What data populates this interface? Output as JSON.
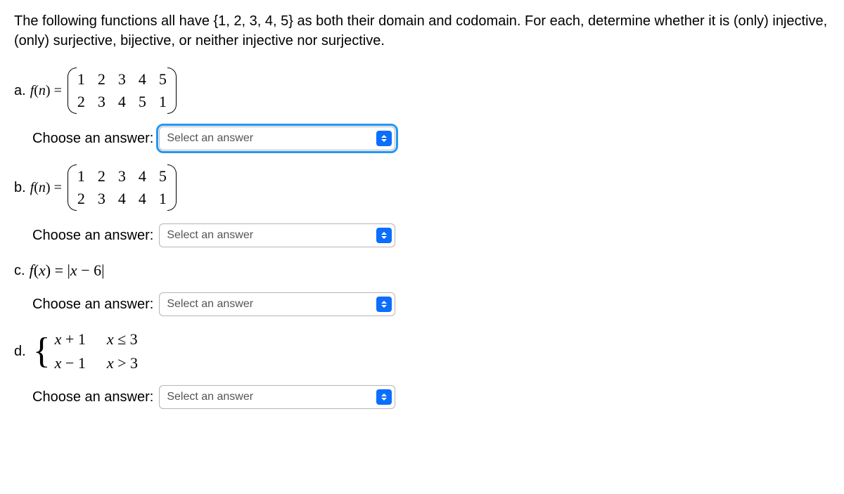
{
  "intro": "The following functions all have {1, 2, 3, 4, 5} as both their domain and codomain. For each, determine whether it is (only) injective, (only) surjective, bijective, or neither injective nor surjective.",
  "parts": {
    "a": {
      "label": "a.",
      "fn_left": "f(n) =",
      "matrix_top": [
        "1",
        "2",
        "3",
        "4",
        "5"
      ],
      "matrix_bot": [
        "2",
        "3",
        "4",
        "5",
        "1"
      ]
    },
    "b": {
      "label": "b.",
      "fn_left": "f(n) =",
      "matrix_top": [
        "1",
        "2",
        "3",
        "4",
        "5"
      ],
      "matrix_bot": [
        "2",
        "3",
        "4",
        "4",
        "1"
      ]
    },
    "c": {
      "label": "c.",
      "expr": "f(x) = |x − 6|"
    },
    "d": {
      "label": "d.",
      "piece1_expr": "x + 1",
      "piece1_cond": "x ≤ 3",
      "piece2_expr": "x − 1",
      "piece2_cond": "x > 3"
    }
  },
  "answer_label": "Choose an answer:",
  "select_placeholder": "Select an answer"
}
